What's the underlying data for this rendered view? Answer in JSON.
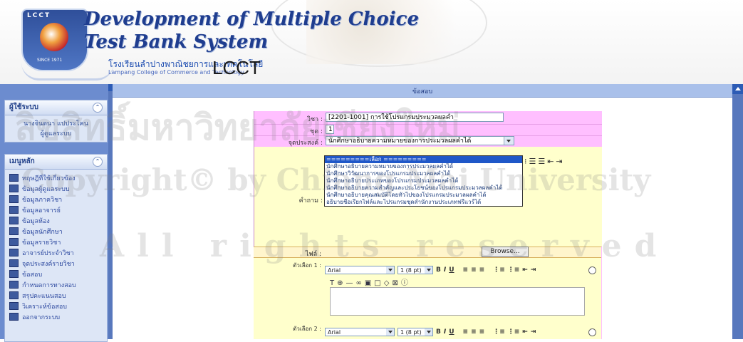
{
  "header": {
    "title_line1": "Development of Multiple Choice",
    "title_line2": "Test Bank System",
    "school_th": "โรงเรียนลำปางพาณิชยการและเทคโนโลยี",
    "school_en": "Lampang College of Commerce and Technology",
    "school_abbr": "LCCT",
    "logo_text": "LCCT",
    "logo_since": "SINCE 1971"
  },
  "sidebar": {
    "user_panel_title": "ผู้ใช้ระบบ",
    "user_name": "นางจินตนา แปประโคน",
    "user_role": "ผู้ดูแลระบบ",
    "menu_title": "เมนูหลัก",
    "menu_items": [
      "ทฤษฎีที่ใช้เกี่ยวข้อง",
      "ข้อมูลผู้ดูแลระบบ",
      "ข้อมูลภาควิชา",
      "ข้อมูลอาจารย์",
      "ข้อมูลห้อง",
      "ข้อมูลนักศึกษา",
      "ข้อมูลรายวิชา",
      "อาจารย์ประจำวิชา",
      "จุดประสงค์รายวิชา",
      "ข้อสอบ",
      "กำหนดการทางสอบ",
      "สรุปคะแนนสอบ",
      "วิเคราะห์ข้อสอบ",
      "ออกจากระบบ"
    ]
  },
  "main": {
    "section_title": "ข้อสอบ",
    "form": {
      "subject_label": "วิชา :",
      "subject_value": "[2201-1001] การใช้โปรแกรมประมวลผลคำ",
      "set_label": "ชุด :",
      "set_value": "1",
      "objective_label": "จุดประสงค์ :",
      "objective_value": "นักศึกษาอธิบายความหมายของการประมวลผลคำได้",
      "question_label": "คำถาม :",
      "file_label": "ไฟล์ :",
      "browse_label": "Browse...",
      "choice1_label": "ตัวเลือก 1 :",
      "choice2_label": "ตัวเลือก 2 :",
      "font_value": "Arial",
      "size_value": "1 (8 pt)"
    },
    "objective_options": [
      "=========เลือก =========",
      "นักศึกษาอธิบายความหมายของการประมวลผลคำได้",
      "นักศึกษาวิวัฒนาการของโปรแกรมประมวลผลคำได้",
      "นักศึกษาอธิบายประเภทของโปรแกรมประมวลผลคำได้",
      "นักศึกษาอธิบายความสำคัญและประโยชน์ของโปรแกรมประมวลผลคำได้",
      "นักศึกษาอธิบายคุณสมบัติโดยทั่วไปของโปรแกรมประมวลผลคำได้",
      "อธิบายชื่อเรียกไฟล์และโปรแกรมชุดสำนักงานประเภทฟรีแวร์ได้"
    ],
    "highlighted_index": 0
  },
  "watermark": {
    "line1": "ลิขสิทธิ์มหาวิทยาลัยเชียงใหม่",
    "line2": "Copyright© by Chiang Mai University",
    "line3": "All rights reserved"
  },
  "colors": {
    "form_bg": "#ffbfff",
    "editor_bg": "#ffffcc",
    "sidebar_bg": "#6c8ccf",
    "title_blue": "#1f3d8f"
  }
}
